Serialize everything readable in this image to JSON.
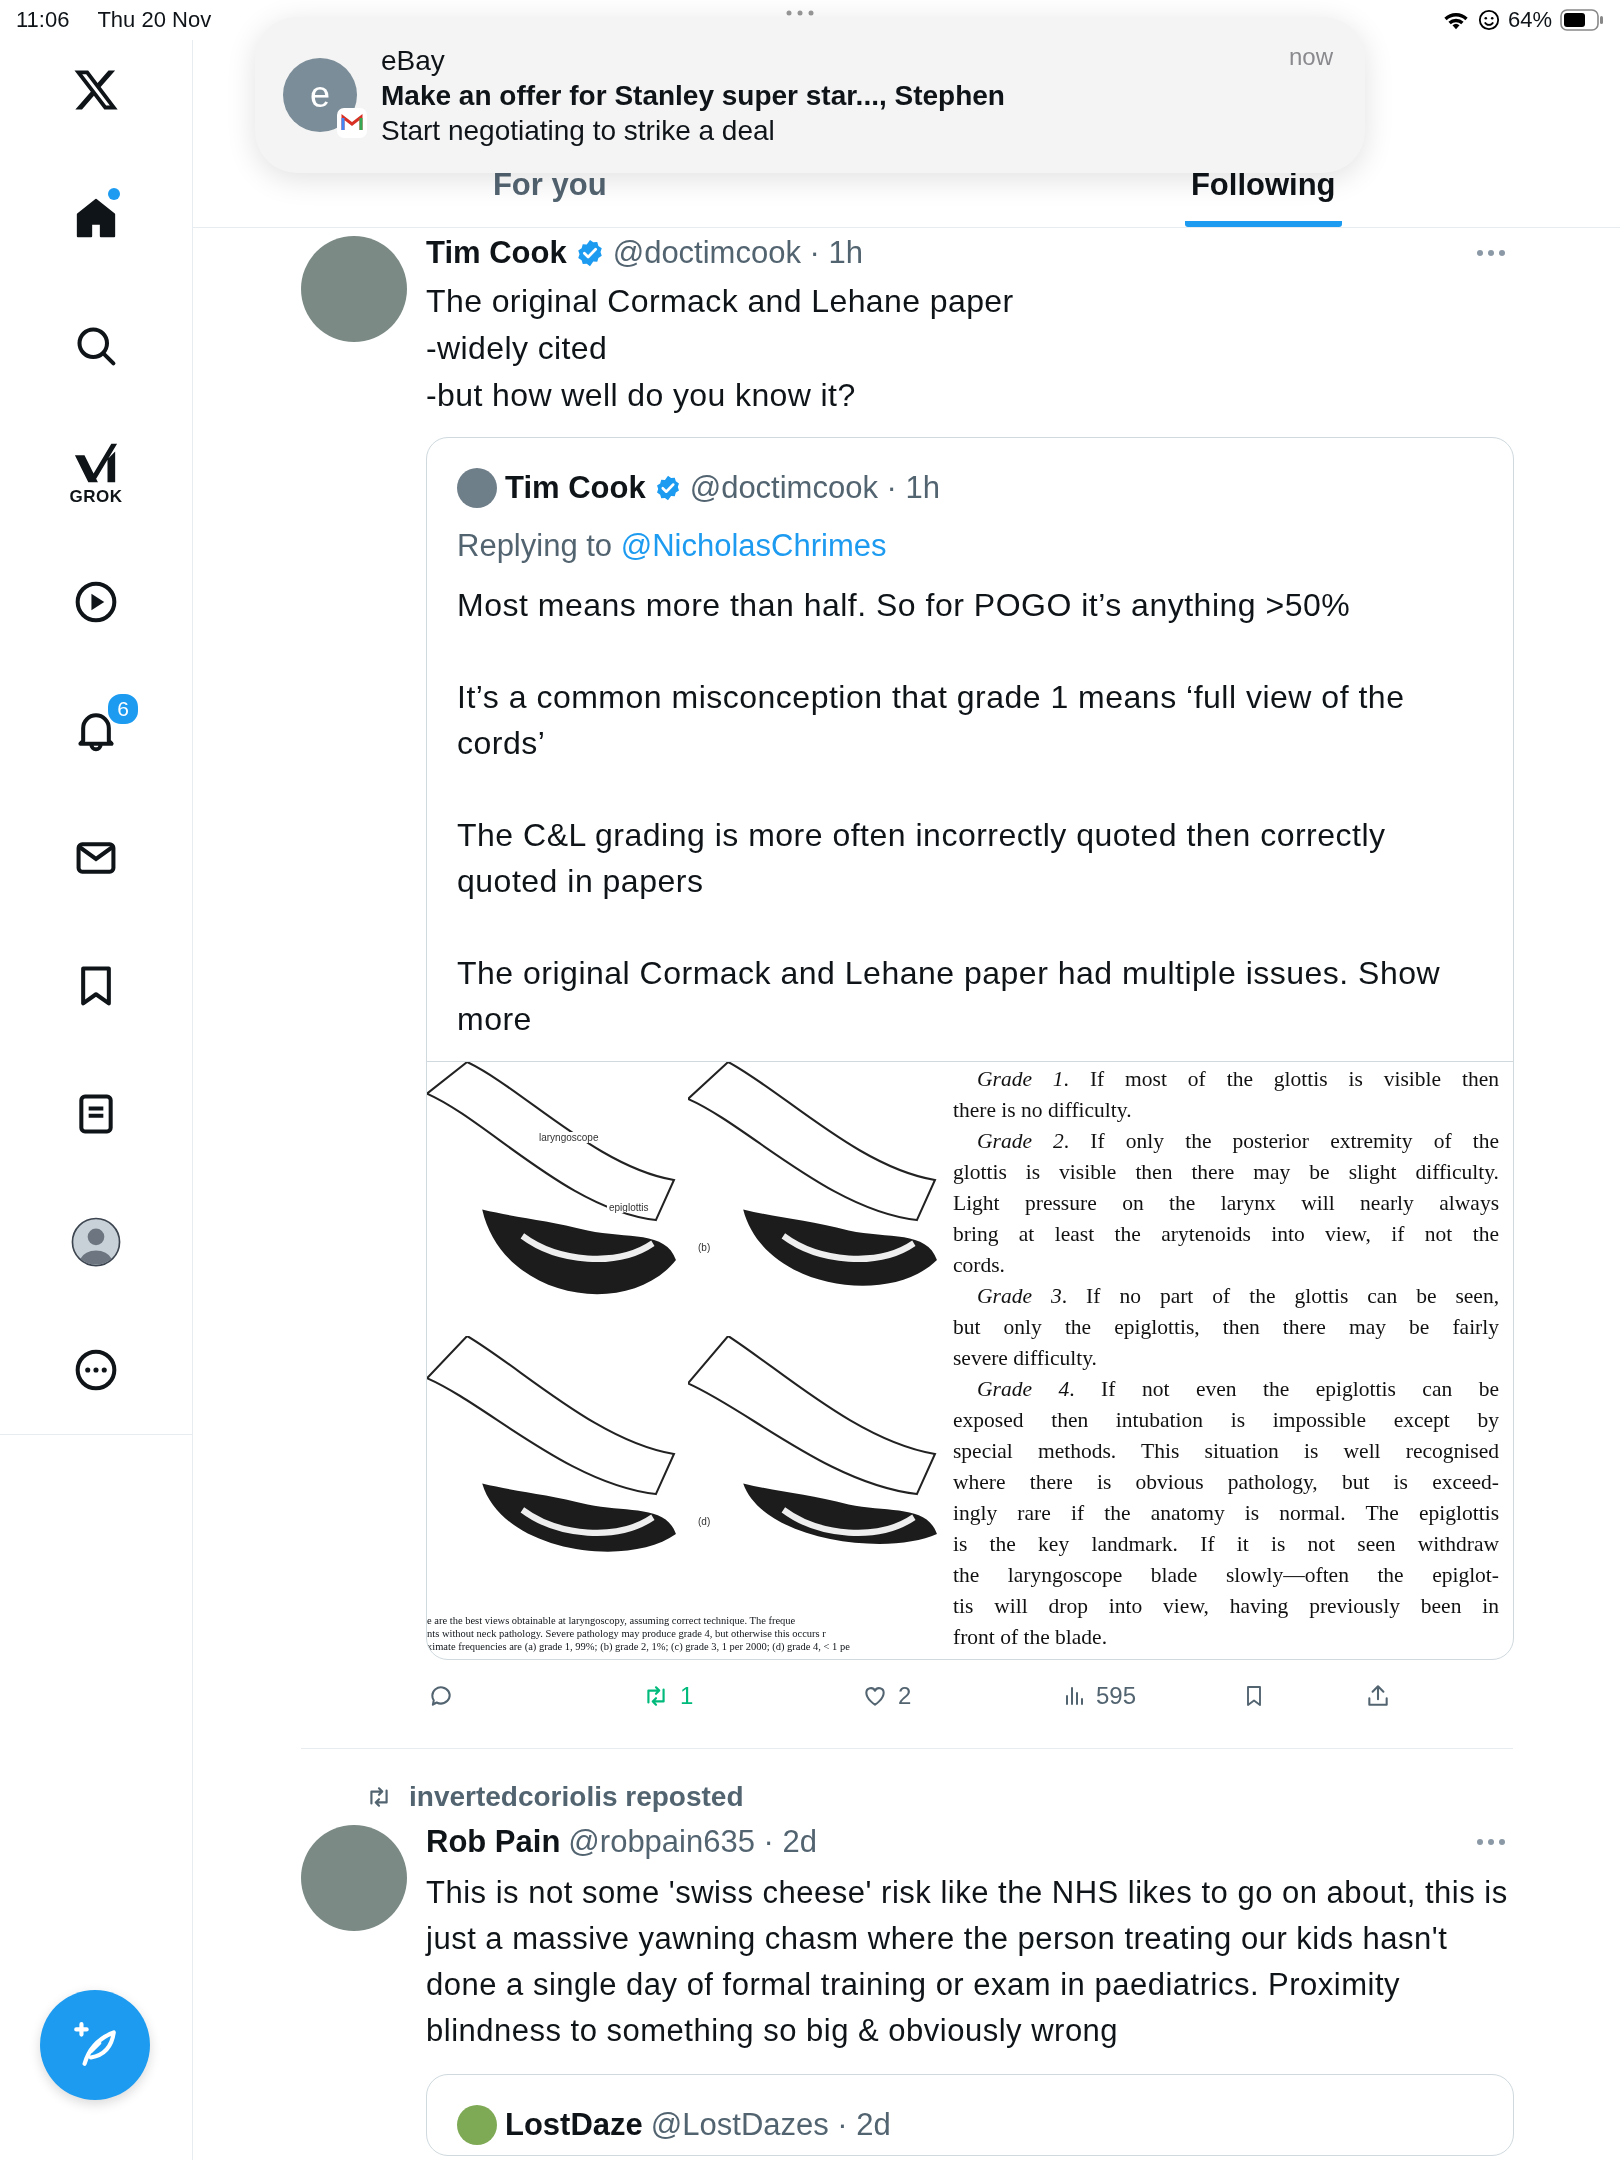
{
  "status_bar": {
    "time": "11:06",
    "date": "Thu 20 Nov",
    "battery": "64%"
  },
  "notification": {
    "app": "eBay",
    "avatar_letter": "e",
    "title": "Make an offer for Stanley super star..., Stephen",
    "body": "Start negotiating to strike a deal",
    "time": "now"
  },
  "sidebar": {
    "items": [
      {
        "kind": "logo"
      },
      {
        "kind": "home",
        "dot": true
      },
      {
        "kind": "search"
      },
      {
        "kind": "grok",
        "label": "GROK"
      },
      {
        "kind": "video"
      },
      {
        "kind": "notifications",
        "badge": "6"
      },
      {
        "kind": "messages"
      },
      {
        "kind": "bookmarks"
      },
      {
        "kind": "lists"
      },
      {
        "kind": "profile"
      },
      {
        "kind": "more"
      }
    ]
  },
  "tabs": [
    {
      "label": "For you",
      "selected": false
    },
    {
      "label": "Following",
      "selected": true
    }
  ],
  "tweets": [
    {
      "author": "Tim Cook",
      "verified": true,
      "meta": "@doctimcook · 1h",
      "text": [
        "The original Cormack and Lehane paper",
        "-widely cited",
        "-but how well do you know it?"
      ],
      "quote": {
        "author": "Tim Cook",
        "verified": true,
        "meta": "@doctimcook · 1h",
        "replying_label": "Replying to",
        "mention": "@NicholasChrimes",
        "paragraphs": [
          "Most means more than half.  So for POGO it’s anything >50%",
          "It’s a common misconception that grade 1 means ‘full view of the cords’",
          "The C&L grading is more often incorrectly quoted then correctly quoted in papers",
          "The original Cormack and Lehane paper had multiple issues. Show more"
        ],
        "media": {
          "panels": [
            {
              "kind": "larynx",
              "labels": [
                "laryngoscope",
                "epiglottis"
              ]
            },
            {
              "kind": "larynx",
              "labels": [
                "(b)"
              ]
            },
            {
              "kind": "larynx"
            },
            {
              "kind": "larynx",
              "labels": [
                "(d)"
              ]
            }
          ],
          "caption": [
            "e are the best views obtainable at laryngoscopy, assuming correct technique. The freque",
            "nts without neck pathology. Severe pathology may produce grade 4, but otherwise this occurs r",
            "ximate frequencies are (a) grade 1, 99%; (b) grade 2, 1%; (c) grade 3, 1 per 2000; (d) grade 4, < 1 pe"
          ],
          "document": [
            {
              "lines": [
                "*Grade 1*. If most of the glottis is visible then",
                "there is no difficulty."
              ]
            },
            {
              "lines": [
                "*Grade 2*. If only the posterior extremity of the",
                "glottis is visible then there may be slight difficulty.",
                "Light pressure on the larynx will nearly always",
                "bring at least the arytenoids into view, if not the",
                "cords."
              ]
            },
            {
              "lines": [
                "*Grade 3*. If no part of the glottis can be seen,",
                "but only the epiglottis, then there may be fairly",
                "severe difficulty."
              ]
            },
            {
              "lines": [
                "*Grade 4*. If not even the epiglottis can be",
                "exposed then intubation is impossible except by",
                "special methods. This situation is well recognised",
                "where there is obvious pathology, but is exceed-",
                "ingly rare if the anatomy is normal. The epiglottis",
                "is the key landmark. If it is not seen withdraw",
                "the laryngoscope blade slowly—often the epiglot-",
                "tis will drop into view, having previously been in",
                "front of the blade."
              ]
            }
          ]
        }
      },
      "actions": [
        {
          "kind": "reply",
          "active": false
        },
        {
          "kind": "repost",
          "count": "1",
          "active": true
        },
        {
          "kind": "like",
          "count": "2",
          "active": false
        },
        {
          "kind": "views",
          "count": "595",
          "active": false
        },
        {
          "kind": "bookmark",
          "active": false
        },
        {
          "kind": "share",
          "active": false
        }
      ]
    },
    {
      "reposted_by": "invertedcoriolis reposted",
      "author": "Rob Pain",
      "verified": false,
      "meta": "@robpain635 · 2d",
      "text": [
        "This is not some 'swiss cheese' risk like the NHS likes to go on about, this is just a massive yawning chasm where the person treating our kids hasn't done a single day of formal training or exam in paediatrics. Proximity blindness to something so big & obviously wrong"
      ],
      "quote": {
        "author": "LostDaze",
        "verified": false,
        "meta": "@LostDazes · 2d"
      }
    }
  ]
}
